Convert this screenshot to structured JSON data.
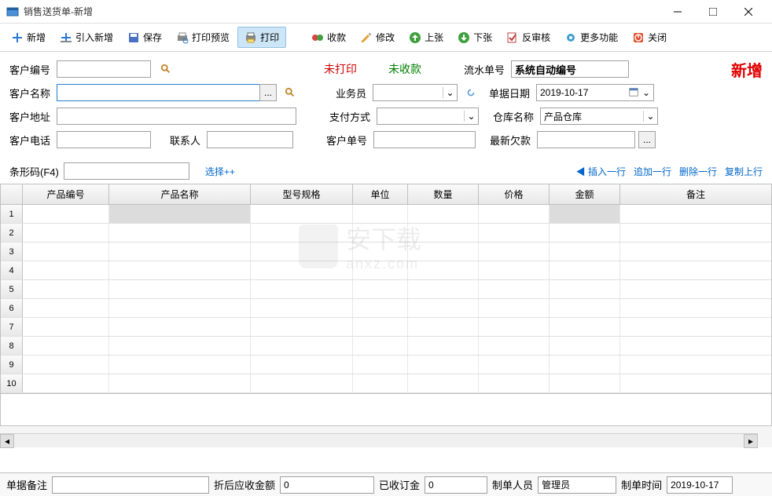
{
  "window": {
    "title": "销售送货单-新增"
  },
  "toolbar": {
    "new": "新增",
    "import_new": "引入新增",
    "save": "保存",
    "print_preview": "打印预览",
    "print": "打印",
    "receive": "收款",
    "modify": "修改",
    "prev": "上张",
    "next": "下张",
    "unaudit": "反审核",
    "more": "更多功能",
    "close": "关闭"
  },
  "form": {
    "customer_no_label": "客户编号",
    "customer_no": "",
    "customer_name_label": "客户名称",
    "customer_name": "",
    "customer_addr_label": "客户地址",
    "customer_addr": "",
    "customer_tel_label": "客户电话",
    "customer_tel": "",
    "contact_label": "联系人",
    "contact": "",
    "status_unprinted": "未打印",
    "status_unpaid": "未收款",
    "salesman_label": "业务员",
    "salesman": "",
    "pay_method_label": "支付方式",
    "pay_method": "",
    "customer_order_label": "客户单号",
    "customer_order": "",
    "serial_label": "流水单号",
    "serial": "系统自动编号",
    "bill_date_label": "单据日期",
    "bill_date": "2019-10-17",
    "warehouse_label": "仓库名称",
    "warehouse": "产品仓库",
    "last_debt_label": "最新欠款",
    "last_debt": "",
    "mode_badge": "新增"
  },
  "barcode": {
    "label": "条形码(F4)",
    "value": "",
    "choose": "选择++"
  },
  "row_actions": {
    "insert": "◀ 插入一行",
    "append": "追加一行",
    "delete": "删除一行",
    "copy_prev": "复制上行"
  },
  "grid": {
    "headers": [
      "产品编号",
      "产品名称",
      "型号规格",
      "单位",
      "数量",
      "价格",
      "金额",
      "备注"
    ],
    "row_count": 10
  },
  "footer": {
    "remark_label": "单据备注",
    "remark": "",
    "after_discount_label": "折后应收金额",
    "after_discount": "0",
    "deposit_label": "已收订金",
    "deposit": "0",
    "maker_label": "制单人员",
    "maker": "管理员",
    "make_time_label": "制单时间",
    "make_time": "2019-10-17"
  }
}
